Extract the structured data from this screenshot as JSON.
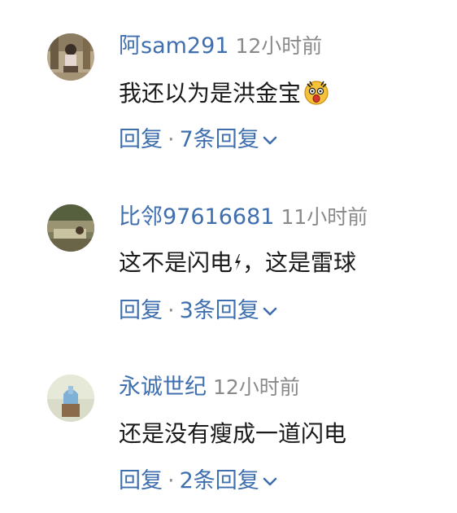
{
  "comments": [
    {
      "username": "阿sam291",
      "time": "12小时前",
      "text": "我还以为是洪金宝",
      "reply_label": "回复",
      "separator": "·",
      "replies_label": "7条回复"
    },
    {
      "username": "比邻97616681",
      "time": "11小时前",
      "text_before": "这不是闪电",
      "text_after": "，这是雷球",
      "reply_label": "回复",
      "separator": "·",
      "replies_label": "3条回复"
    },
    {
      "username": "永诚世纪",
      "time": "12小时前",
      "text": "还是没有瘦成一道闪电",
      "reply_label": "回复",
      "separator": "·",
      "replies_label": "2条回复"
    }
  ],
  "icons": {
    "emoji": "surprised-face-emoji",
    "lightning": "lightning-bolt",
    "expand": "chevron-down"
  },
  "colors": {
    "link": "#3f6fae",
    "meta": "#8a8a8a",
    "text": "#1a1a1a"
  }
}
